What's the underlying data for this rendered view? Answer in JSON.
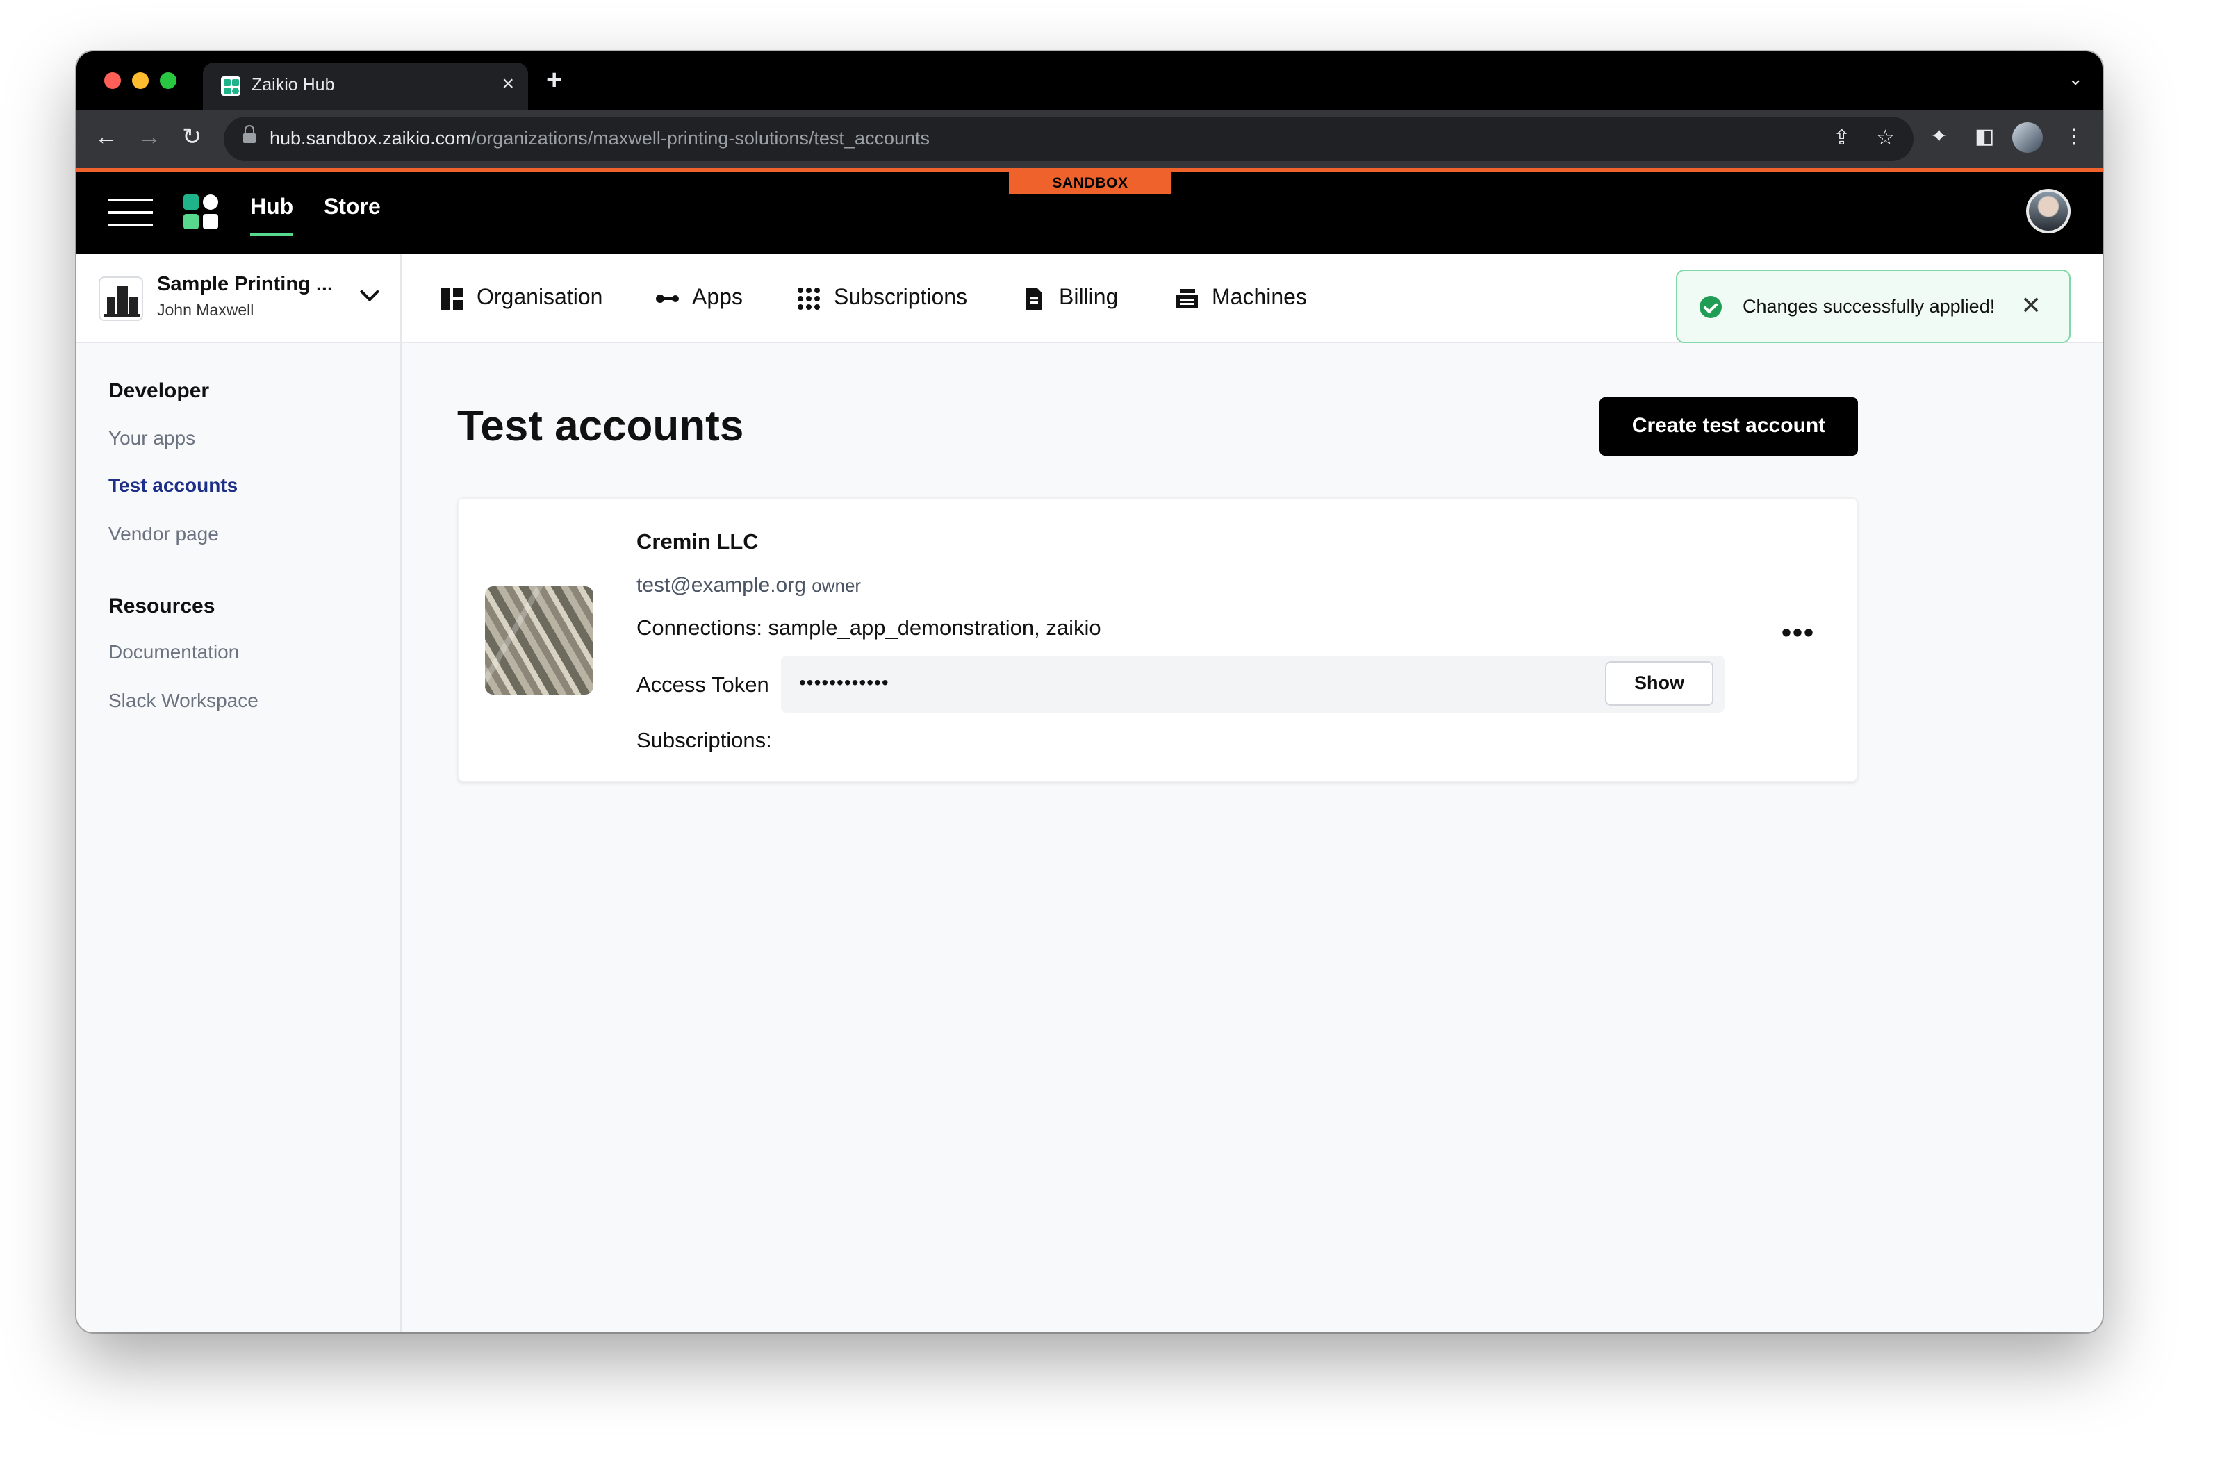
{
  "browser": {
    "tab_title": "Zaikio Hub",
    "tab_close": "×",
    "new_tab": "+",
    "url_host": "hub.sandbox.zaikio.com",
    "url_path": "/organizations/maxwell-printing-solutions/test_accounts"
  },
  "header": {
    "sandbox_label": "SANDBOX",
    "nav": [
      {
        "label": "Hub",
        "active": true
      },
      {
        "label": "Store",
        "active": false
      }
    ]
  },
  "org": {
    "name": "Sample Printing ...",
    "user": "John Maxwell"
  },
  "subnav": [
    {
      "label": "Organisation",
      "icon": "organisation-icon"
    },
    {
      "label": "Apps",
      "icon": "apps-icon"
    },
    {
      "label": "Subscriptions",
      "icon": "subscriptions-icon"
    },
    {
      "label": "Billing",
      "icon": "billing-icon"
    },
    {
      "label": "Machines",
      "icon": "machines-icon"
    }
  ],
  "toast": {
    "message": "Changes successfully applied!",
    "close": "✕"
  },
  "sidebar": {
    "sections": [
      {
        "title": "Developer",
        "items": [
          {
            "label": "Your apps",
            "active": false
          },
          {
            "label": "Test accounts",
            "active": true
          },
          {
            "label": "Vendor page",
            "active": false
          }
        ]
      },
      {
        "title": "Resources",
        "items": [
          {
            "label": "Documentation",
            "active": false
          },
          {
            "label": "Slack Workspace",
            "active": false
          }
        ]
      }
    ]
  },
  "main": {
    "title": "Test accounts",
    "create_button": "Create test account",
    "account": {
      "name": "Cremin LLC",
      "email": "test@example.org",
      "role": "owner",
      "connections": "Connections: sample_app_demonstration, zaikio",
      "token_label": "Access Token",
      "token_masked": "••••••••••••",
      "show_button": "Show",
      "subscriptions": "Subscriptions:",
      "more": "•••"
    }
  },
  "colors": {
    "sandbox_orange": "#f0622b",
    "brand_green": "#57d88e",
    "active_link": "#1e2f8a",
    "toast_border": "#7fd9a6"
  }
}
